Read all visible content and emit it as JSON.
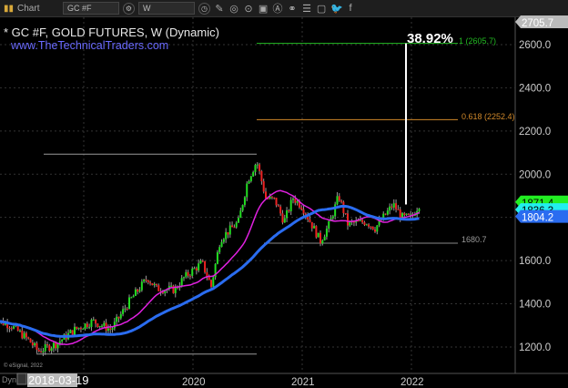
{
  "toolbar": {
    "app_label": "Chart",
    "symbol": "GC #F",
    "interval": "W",
    "icons": [
      "chart-app-icon",
      "symbol-settings-icon",
      "interval-clock-icon",
      "pencil-icon",
      "compare-icon",
      "play-icon",
      "text-icon",
      "alert-icon",
      "link-icon",
      "list-icon",
      "comment-icon",
      "twitter-icon",
      "facebook-icon"
    ]
  },
  "chart": {
    "title": "* GC #F, GOLD FUTURES, W (Dynamic)",
    "website": "www.TheTechnicalTraders.com",
    "copyright": "© eSignal, 2022",
    "percent_label": "38.92%",
    "fib_1_label": "1 (2605.7)",
    "fib_618_label": "0.618 (2252.4)",
    "support_label": "1680.7",
    "dyn_label": "Dyn",
    "cursor_date": "2018-03-19"
  },
  "colors": {
    "up": "#22dd22",
    "down": "#ee2222",
    "ma_fast": "#e020e0",
    "ma_slow": "#2a6cf0",
    "fib1": "#22bb22",
    "fib618": "#d0882a",
    "support": "#888888"
  },
  "chart_data": {
    "type": "candlestick",
    "interval": "weekly",
    "ylim": [
      1130,
      2720
    ],
    "y_ticks": [
      "2600.0",
      "2400.0",
      "2200.0",
      "2000.0",
      "1600.0",
      "1400.0",
      "1200.0"
    ],
    "x_ticks": [
      "2020",
      "2021",
      "2022"
    ],
    "price_tags": [
      {
        "value": "2705.7",
        "color": "#bbbbbb"
      },
      {
        "value": "1871.4",
        "color": "#22ee22"
      },
      {
        "value": "1836.3",
        "color": "#22eeee"
      },
      {
        "value": "1804.2",
        "color": "#2a6cf0"
      }
    ],
    "approx_closes": [
      [
        "2018-03",
        1330
      ],
      [
        "2018-05",
        1300
      ],
      [
        "2018-07",
        1230
      ],
      [
        "2018-08",
        1180
      ],
      [
        "2018-10",
        1215
      ],
      [
        "2018-12",
        1280
      ],
      [
        "2019-02",
        1320
      ],
      [
        "2019-04",
        1280
      ],
      [
        "2019-06",
        1410
      ],
      [
        "2019-08",
        1520
      ],
      [
        "2019-09",
        1470
      ],
      [
        "2019-11",
        1465
      ],
      [
        "2019-12",
        1520
      ],
      [
        "2020-02",
        1590
      ],
      [
        "2020-03",
        1480
      ],
      [
        "2020-04",
        1700
      ],
      [
        "2020-06",
        1780
      ],
      [
        "2020-07",
        1970
      ],
      [
        "2020-08",
        2060
      ],
      [
        "2020-09",
        1890
      ],
      [
        "2020-10",
        1880
      ],
      [
        "2020-11",
        1780
      ],
      [
        "2020-12",
        1890
      ],
      [
        "2021-01",
        1850
      ],
      [
        "2021-03",
        1690
      ],
      [
        "2021-04",
        1770
      ],
      [
        "2021-05",
        1900
      ],
      [
        "2021-06",
        1770
      ],
      [
        "2021-08",
        1780
      ],
      [
        "2021-09",
        1750
      ],
      [
        "2021-11",
        1860
      ],
      [
        "2021-12",
        1800
      ],
      [
        "2022-01",
        1800
      ],
      [
        "2022-02",
        1871
      ]
    ],
    "levels": {
      "fib_1": 2605.7,
      "fib_0618": 2252.4,
      "support": 1680.7,
      "upper_gray": 2093,
      "lower_gray": 1167
    },
    "moving_averages": [
      {
        "color": "magenta",
        "length": 20
      },
      {
        "color": "blue",
        "length": 50
      }
    ]
  }
}
